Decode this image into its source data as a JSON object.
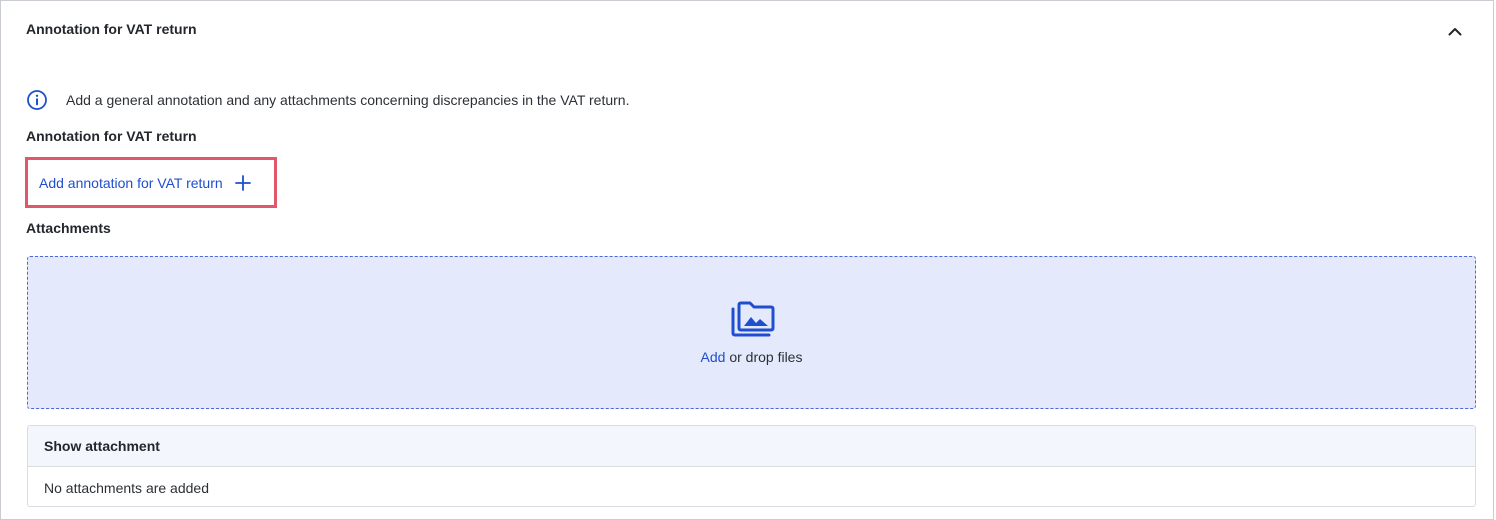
{
  "panel": {
    "title": "Annotation for VAT return",
    "info_text": "Add a general annotation and any attachments concerning discrepancies in the VAT return."
  },
  "annotation": {
    "section_label": "Annotation for VAT return",
    "add_label": "Add annotation for VAT return"
  },
  "attachments": {
    "section_label": "Attachments",
    "dropzone_add": "Add",
    "dropzone_rest": " or drop files",
    "table_header": "Show attachment",
    "empty_text": "No attachments are added"
  },
  "colors": {
    "accent": "#1f4fcf",
    "highlight_border": "#e0586a",
    "dropzone_bg": "#e4eafb"
  },
  "icons": {
    "collapse": "chevron-up-icon",
    "info": "info-circle-icon",
    "add": "plus-icon",
    "upload": "folder-images-icon"
  }
}
